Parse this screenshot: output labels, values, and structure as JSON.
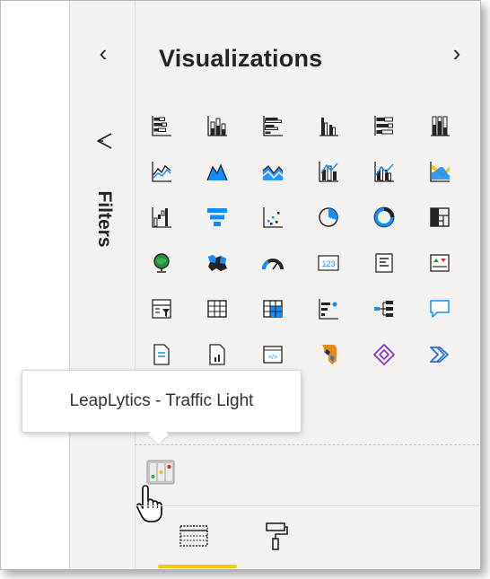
{
  "filters_pane": {
    "collapse_glyph": "‹",
    "label": "Filters",
    "icon": "funnel-icon"
  },
  "visualizations_pane": {
    "title": "Visualizations",
    "expand_glyph": "›",
    "icons": [
      "stacked-bar-chart-icon",
      "stacked-column-chart-icon",
      "clustered-bar-chart-icon",
      "clustered-column-chart-icon",
      "100-stacked-bar-chart-icon",
      "100-stacked-column-chart-icon",
      "line-chart-icon",
      "area-chart-icon",
      "stacked-area-chart-icon",
      "line-and-stacked-column-icon",
      "line-and-clustered-column-icon",
      "ribbon-chart-icon",
      "waterfall-chart-icon",
      "funnel-chart-icon",
      "scatter-chart-icon",
      "pie-chart-icon",
      "donut-chart-icon",
      "treemap-icon",
      "map-icon",
      "filled-map-icon",
      "gauge-icon",
      "card-icon",
      "multi-row-card-icon",
      "kpi-icon",
      "slicer-icon",
      "table-icon",
      "matrix-icon",
      "key-influencers-icon",
      "decomposition-tree-icon",
      "qa-icon",
      "paginated-report-icon",
      "smart-narrative-icon",
      "html-content-icon",
      "custom-visual-orange-icon",
      "power-apps-icon",
      "power-automate-icon"
    ],
    "custom_visual": {
      "icon": "traffic-light-icon",
      "tooltip": "LeapLytics - Traffic Light"
    },
    "bottom_tabs": [
      {
        "name": "fields",
        "icon": "fields-icon"
      },
      {
        "name": "format",
        "icon": "paint-roller-icon"
      }
    ],
    "colors": {
      "pane_bg": "#f3f2f1",
      "accent_underline": "#f2c811",
      "icon_dark": "#252423",
      "icon_blue": "#118dff"
    }
  }
}
